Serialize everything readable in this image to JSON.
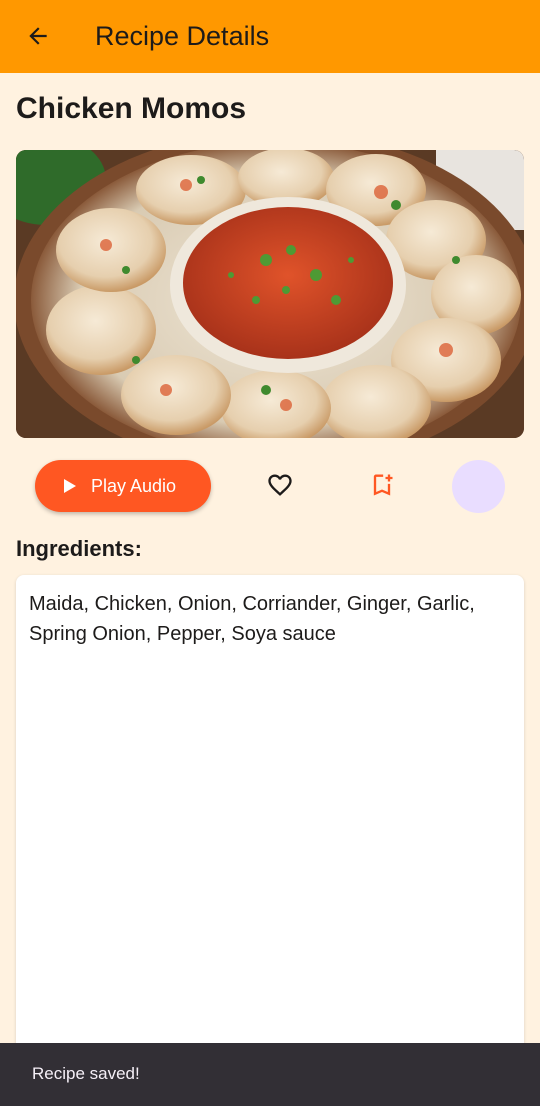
{
  "appbar": {
    "title": "Recipe Details",
    "back_icon": "arrow-back-icon",
    "background": "#ff9800"
  },
  "recipe": {
    "name": "Chicken Momos",
    "image_alt": "Plate of chicken momos around a bowl of red chutney"
  },
  "actions": {
    "play_label": "Play Audio",
    "play_icon": "play-icon",
    "favorite_icon": "heart-outline-icon",
    "bookmark_icon": "bookmark-add-icon",
    "accent": "#ff5722",
    "fab_color": "#e9ddff"
  },
  "ingredients": {
    "heading": "Ingredients:",
    "text": "Maida, Chicken, Onion, Corriander, Ginger, Garlic, Spring Onion, Pepper, Soya sauce"
  },
  "snackbar": {
    "message": "Recipe saved!"
  },
  "colors": {
    "page_background": "#fff2e0",
    "snackbar_background": "#322f35"
  }
}
